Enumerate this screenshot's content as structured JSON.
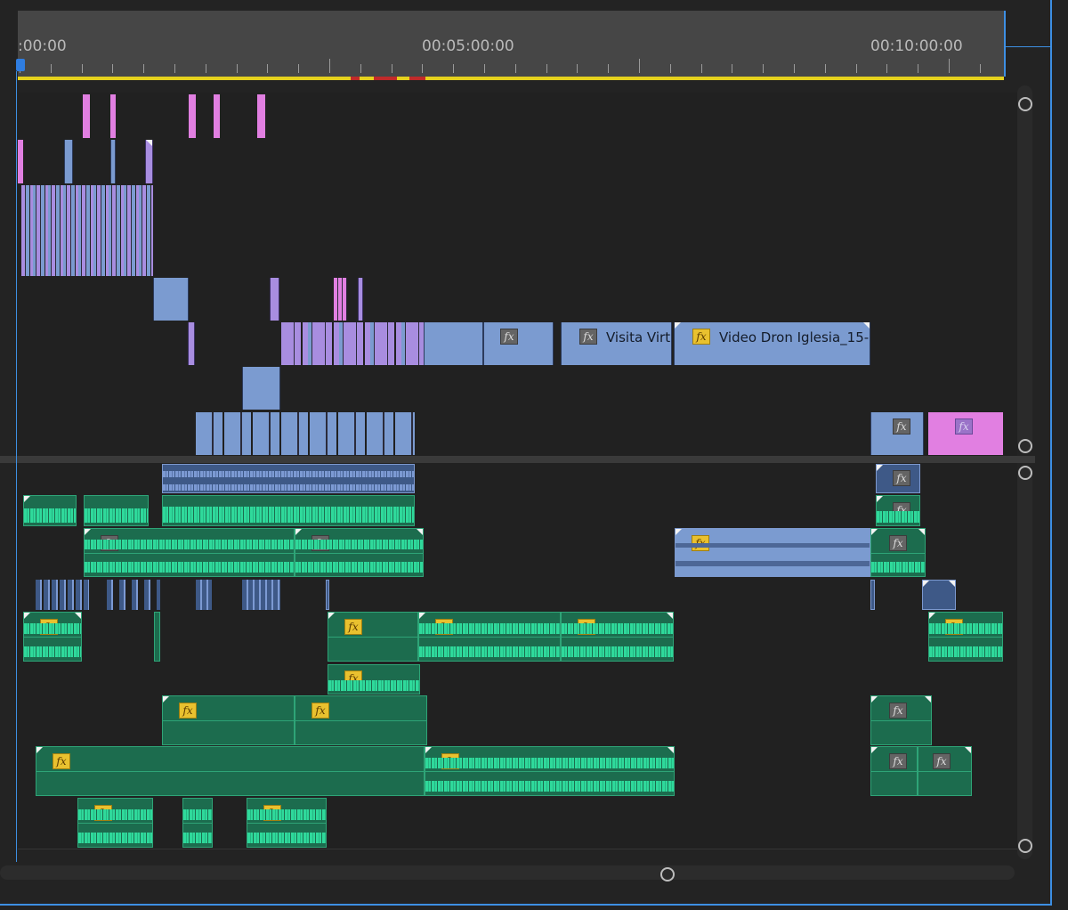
{
  "timeline": {
    "timecodes": {
      "start": ":00:00",
      "mid": "00:05:00:00",
      "end": "00:10:00:00"
    },
    "clips": {
      "visita": "Visita Virt",
      "video_dron": "Video Dron Iglesia_15-"
    },
    "fx_label": "fx"
  },
  "colors": {
    "video_blue": "#7b9bd0",
    "video_lavender": "#a88de0",
    "video_pink": "#e17fe1",
    "audio_green": "#2fd99b",
    "audio_blue": "#3e5987",
    "playhead": "#3d8fe3",
    "work_area": "#e5d11c"
  }
}
